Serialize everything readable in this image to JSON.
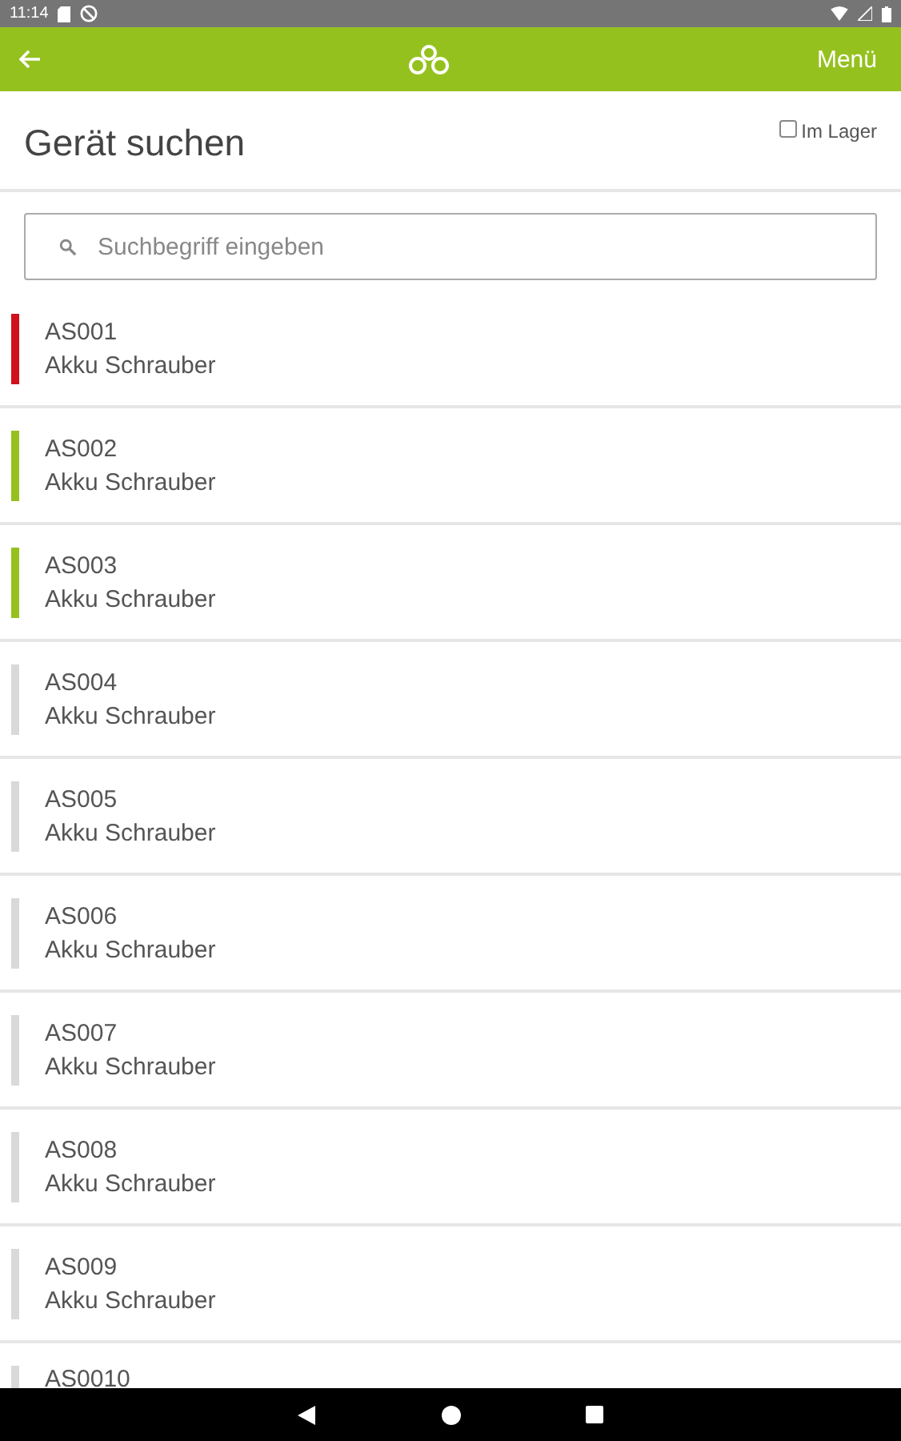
{
  "status_bar": {
    "time": "11:14"
  },
  "app_bar": {
    "menu": "Menü"
  },
  "page": {
    "title": "Gerät suchen",
    "in_stock_filter": {
      "label": "Im Lager",
      "checked": false
    }
  },
  "search": {
    "placeholder": "Suchbegriff eingeben"
  },
  "devices": [
    {
      "id": "AS001",
      "name": "Akku Schrauber",
      "color": "#d0101b"
    },
    {
      "id": "AS002",
      "name": "Akku Schrauber",
      "color": "#95c11f"
    },
    {
      "id": "AS003",
      "name": "Akku Schrauber",
      "color": "#95c11f"
    },
    {
      "id": "AS004",
      "name": "Akku Schrauber",
      "color": "#d9d9d9"
    },
    {
      "id": "AS005",
      "name": "Akku Schrauber",
      "color": "#d9d9d9"
    },
    {
      "id": "AS006",
      "name": "Akku Schrauber",
      "color": "#d9d9d9"
    },
    {
      "id": "AS007",
      "name": "Akku Schrauber",
      "color": "#d9d9d9"
    },
    {
      "id": "AS008",
      "name": "Akku Schrauber",
      "color": "#d9d9d9"
    },
    {
      "id": "AS009",
      "name": "Akku Schrauber",
      "color": "#d9d9d9"
    },
    {
      "id": "AS0010",
      "color": "#d9d9d9"
    }
  ]
}
